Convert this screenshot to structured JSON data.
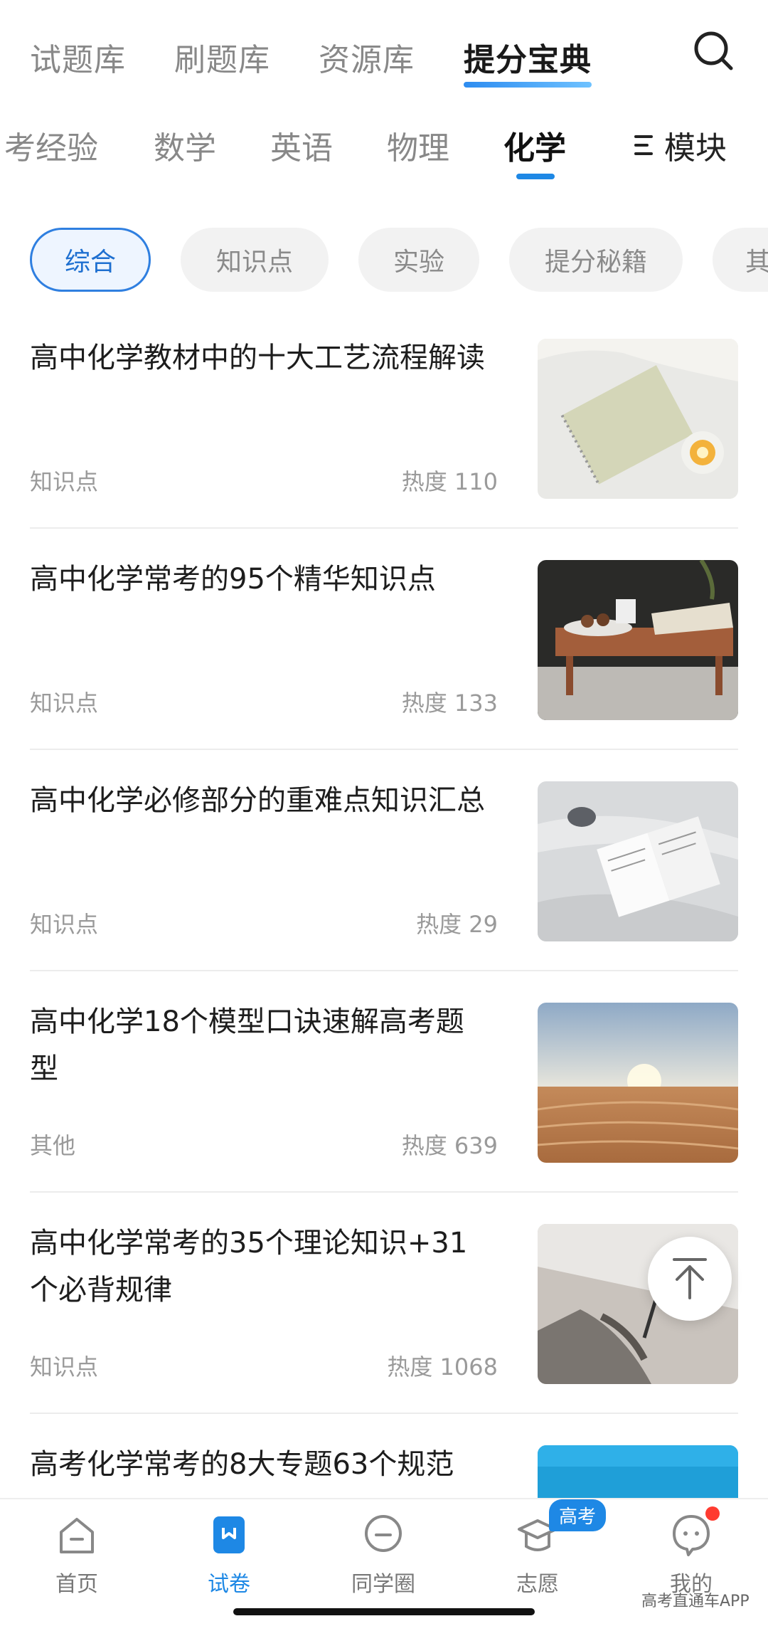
{
  "top_tabs": [
    "试题库",
    "刷题库",
    "资源库",
    "提分宝典"
  ],
  "subject_tabs": [
    "考经验",
    "数学",
    "英语",
    "物理",
    "化学"
  ],
  "module_label": "模块",
  "chips": [
    "综合",
    "知识点",
    "实验",
    "提分秘籍",
    "其"
  ],
  "articles": [
    {
      "title": "高中化学教材中的十大工艺流程解读",
      "tag": "知识点",
      "heat": "热度 110"
    },
    {
      "title": "高中化学常考的95个精华知识点",
      "tag": "知识点",
      "heat": "热度 133"
    },
    {
      "title": "高中化学必修部分的重难点知识汇总",
      "tag": "知识点",
      "heat": "热度 29"
    },
    {
      "title": "高中化学18个模型口诀速解高考题型",
      "tag": "其他",
      "heat": "热度 639"
    },
    {
      "title": "高中化学常考的35个理论知识+31个必背规律",
      "tag": "知识点",
      "heat": "热度 1068"
    },
    {
      "title": "高考化学常考的8大专题63个规范",
      "tag": "",
      "heat": ""
    }
  ],
  "bottom_nav": [
    "首页",
    "试卷",
    "同学圈",
    "志愿",
    "我的"
  ],
  "badge": "高考",
  "watermark": "高考直通车APP",
  "colors": {
    "accent": "#1e88e5",
    "chip_active_border": "#2f7fe0",
    "red_dot": "#ff3b30"
  }
}
